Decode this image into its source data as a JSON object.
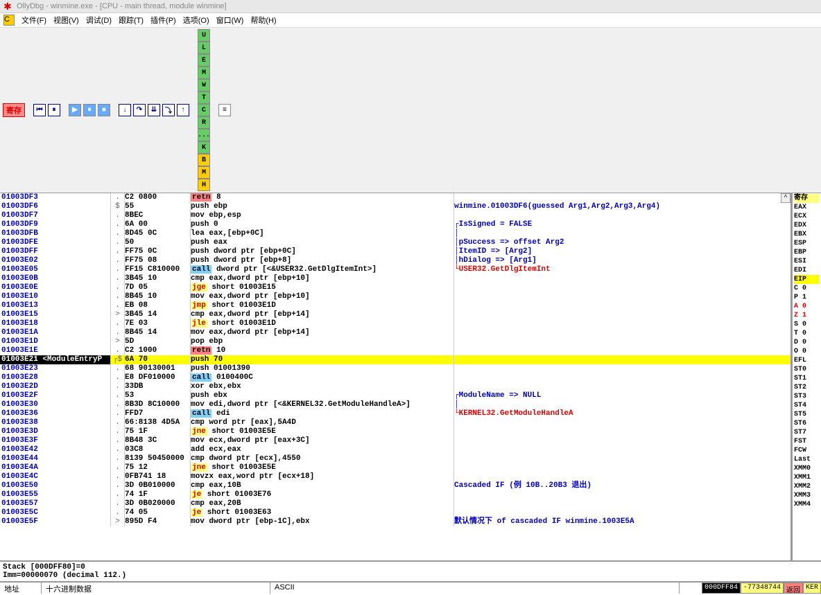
{
  "title": "OllyDbg - winmine.exe - [CPU - main thread, module winmine]",
  "menu": {
    "file": "文件(F)",
    "view": "视图(V)",
    "debug": "调试(D)",
    "trace": "跟踪(T)",
    "plugin": "插件(P)",
    "options": "选项(O)",
    "window": "窗口(W)",
    "help": "帮助(H)"
  },
  "toolbar_label": "寄存",
  "toolbar_letters": [
    "U",
    "L",
    "E",
    "M",
    "W",
    "T",
    "C",
    "R",
    "...",
    "K",
    "B",
    "M",
    "H"
  ],
  "reg_header": "寄存",
  "registers": [
    {
      "n": "EAX",
      "c": ""
    },
    {
      "n": "ECX",
      "c": ""
    },
    {
      "n": "EDX",
      "c": ""
    },
    {
      "n": "EBX",
      "c": ""
    },
    {
      "n": "ESP",
      "c": ""
    },
    {
      "n": "EBP",
      "c": ""
    },
    {
      "n": "ESI",
      "c": ""
    },
    {
      "n": "EDI",
      "c": ""
    },
    {
      "n": "",
      "c": ""
    },
    {
      "n": "EIP",
      "c": "hl"
    },
    {
      "n": "",
      "c": ""
    },
    {
      "n": "C 0",
      "c": ""
    },
    {
      "n": "P 1",
      "c": ""
    },
    {
      "n": "A 0",
      "c": "red"
    },
    {
      "n": "Z 1",
      "c": "red"
    },
    {
      "n": "S 0",
      "c": ""
    },
    {
      "n": "T 0",
      "c": ""
    },
    {
      "n": "D 0",
      "c": ""
    },
    {
      "n": "O 0",
      "c": ""
    },
    {
      "n": "",
      "c": ""
    },
    {
      "n": "EFL",
      "c": ""
    },
    {
      "n": "",
      "c": ""
    },
    {
      "n": "ST0",
      "c": ""
    },
    {
      "n": "ST1",
      "c": ""
    },
    {
      "n": "ST2",
      "c": ""
    },
    {
      "n": "ST3",
      "c": ""
    },
    {
      "n": "ST4",
      "c": ""
    },
    {
      "n": "ST5",
      "c": ""
    },
    {
      "n": "ST6",
      "c": ""
    },
    {
      "n": "ST7",
      "c": ""
    },
    {
      "n": "",
      "c": ""
    },
    {
      "n": "FST",
      "c": ""
    },
    {
      "n": "FCW",
      "c": ""
    },
    {
      "n": "Last",
      "c": ""
    },
    {
      "n": "",
      "c": ""
    },
    {
      "n": "XMM0",
      "c": ""
    },
    {
      "n": "XMM1",
      "c": ""
    },
    {
      "n": "XMM2",
      "c": ""
    },
    {
      "n": "XMM3",
      "c": ""
    },
    {
      "n": "XMM4",
      "c": ""
    }
  ],
  "disasm": [
    {
      "a": "01003DF3",
      "m": ".",
      "h": "C2 0800",
      "k": "retn",
      "d": " 8",
      "c": ""
    },
    {
      "a": "01003DF6",
      "m": "$",
      "h": "55",
      "k": "",
      "d": "push ebp",
      "c": "winmine.01003DF6(guessed Arg1,Arg2,Arg3,Arg4)"
    },
    {
      "a": "01003DF7",
      "m": ".",
      "h": "8BEC",
      "k": "",
      "d": "mov ebp,esp",
      "c": ""
    },
    {
      "a": "01003DF9",
      "m": ".",
      "h": "6A 00",
      "k": "",
      "d": "push 0",
      "c": "┌IsSigned = FALSE"
    },
    {
      "a": "01003DFB",
      "m": ".",
      "h": "8D45 0C",
      "k": "",
      "d": "lea eax,[ebp+0C]",
      "c": "│"
    },
    {
      "a": "01003DFE",
      "m": ".",
      "h": "50",
      "k": "",
      "d": "push eax",
      "c": "│pSuccess => offset Arg2"
    },
    {
      "a": "01003DFF",
      "m": ".",
      "h": "FF75 0C",
      "k": "",
      "d": "push dword ptr [ebp+0C]",
      "c": "│ItemID => [Arg2]"
    },
    {
      "a": "01003E02",
      "m": ".",
      "h": "FF75 08",
      "k": "",
      "d": "push dword ptr [ebp+8]",
      "c": "│hDialog => [Arg1]"
    },
    {
      "a": "01003E05",
      "m": ".",
      "h": "FF15 C810000",
      "k": "call",
      "d": " dword ptr [<&USER32.GetDlgItemInt>]",
      "c": "└USER32.GetDlgItemInt",
      "cr": 1
    },
    {
      "a": "01003E0B",
      "m": ".",
      "h": "3B45 10",
      "k": "",
      "d": "cmp eax,dword ptr [ebp+10]",
      "c": ""
    },
    {
      "a": "01003E0E",
      "m": ".",
      "h": "7D 05",
      "k": "jge",
      "d": " short 01003E15",
      "c": ""
    },
    {
      "a": "01003E10",
      "m": ".",
      "h": "8B45 10",
      "k": "",
      "d": "mov eax,dword ptr [ebp+10]",
      "c": ""
    },
    {
      "a": "01003E13",
      "m": ".",
      "h": "EB 08",
      "k": "jmp",
      "d": " short 01003E1D",
      "c": ""
    },
    {
      "a": "01003E15",
      "m": ">",
      "h": "3B45 14",
      "k": "",
      "d": "cmp eax,dword ptr [ebp+14]",
      "c": ""
    },
    {
      "a": "01003E18",
      "m": ".",
      "h": "7E 03",
      "k": "jle",
      "d": " short 01003E1D",
      "c": ""
    },
    {
      "a": "01003E1A",
      "m": ".",
      "h": "8B45 14",
      "k": "",
      "d": "mov eax,dword ptr [ebp+14]",
      "c": ""
    },
    {
      "a": "01003E1D",
      "m": ">",
      "h": "5D",
      "k": "",
      "d": "pop ebp",
      "c": ""
    },
    {
      "a": "01003E1E",
      "m": ".",
      "h": "C2 1000",
      "k": "retn",
      "d": " 10",
      "c": ""
    },
    {
      "a": "01003E21 <ModuleEntryP",
      "m": "┌$",
      "h": "6A 70",
      "k": "",
      "d": "push 70",
      "c": "",
      "hl": 1
    },
    {
      "a": "01003E23",
      "m": ".",
      "h": "68 90130001",
      "k": "",
      "d": "push 01001390",
      "c": ""
    },
    {
      "a": "01003E28",
      "m": ".",
      "h": "E8 DF010000",
      "k": "call",
      "d": " 0100400C",
      "c": ""
    },
    {
      "a": "01003E2D",
      "m": ".",
      "h": "33DB",
      "k": "",
      "d": "xor ebx,ebx",
      "c": ""
    },
    {
      "a": "01003E2F",
      "m": ".",
      "h": "53",
      "k": "",
      "d": "push ebx",
      "c": "┌ModuleName => NULL"
    },
    {
      "a": "01003E30",
      "m": ".",
      "h": "8B3D 8C10000",
      "k": "",
      "d": "mov edi,dword ptr [<&KERNEL32.GetModuleHandleA>]",
      "c": "│"
    },
    {
      "a": "01003E36",
      "m": ".",
      "h": "FFD7",
      "k": "call",
      "d": " edi",
      "c": "└KERNEL32.GetModuleHandleA",
      "cr": 1
    },
    {
      "a": "01003E38",
      "m": ".",
      "h": "66:8138 4D5A",
      "k": "",
      "d": "cmp word ptr [eax],5A4D",
      "c": ""
    },
    {
      "a": "01003E3D",
      "m": ".",
      "h": "75 1F",
      "k": "jne",
      "d": " short 01003E5E",
      "c": ""
    },
    {
      "a": "01003E3F",
      "m": ".",
      "h": "8B48 3C",
      "k": "",
      "d": "mov ecx,dword ptr [eax+3C]",
      "c": ""
    },
    {
      "a": "01003E42",
      "m": ".",
      "h": "03C8",
      "k": "",
      "d": "add ecx,eax",
      "c": ""
    },
    {
      "a": "01003E44",
      "m": ".",
      "h": "8139 50450000",
      "k": "",
      "d": "cmp dword ptr [ecx],4550",
      "c": ""
    },
    {
      "a": "01003E4A",
      "m": ".",
      "h": "75 12",
      "k": "jne",
      "d": " short 01003E5E",
      "c": ""
    },
    {
      "a": "01003E4C",
      "m": ".",
      "h": "0FB741 18",
      "k": "",
      "d": "movzx eax,word ptr [ecx+18]",
      "c": ""
    },
    {
      "a": "01003E50",
      "m": ".",
      "h": "3D 0B010000",
      "k": "",
      "d": "cmp eax,10B",
      "c": "Cascaded IF (例 10B..20B3 退出)"
    },
    {
      "a": "01003E55",
      "m": ".",
      "h": "74 1F",
      "k": "je",
      "d": " short 01003E76",
      "c": ""
    },
    {
      "a": "01003E57",
      "m": ".",
      "h": "3D 0B020000",
      "k": "",
      "d": "cmp eax,20B",
      "c": ""
    },
    {
      "a": "01003E5C",
      "m": ".",
      "h": "74 05",
      "k": "je",
      "d": " short 01003E63",
      "c": ""
    },
    {
      "a": "01003E5F",
      "m": ">",
      "h": "895D F4",
      "k": "",
      "d": "mov dword ptr [ebp-1C],ebx",
      "c": "默认情况下 of cascaded IF winmine.1003E5A"
    }
  ],
  "info": {
    "line1": "Stack [000DFF80]=0",
    "line2": "Imm=00000070 (decimal 112.)"
  },
  "bottom": {
    "addr": "地址",
    "hex": "十六进制数据",
    "ascii": "ASCII",
    "status1": "000DFF84",
    "status2": "-77348744",
    "status3": "返回",
    "status4": "KER"
  }
}
